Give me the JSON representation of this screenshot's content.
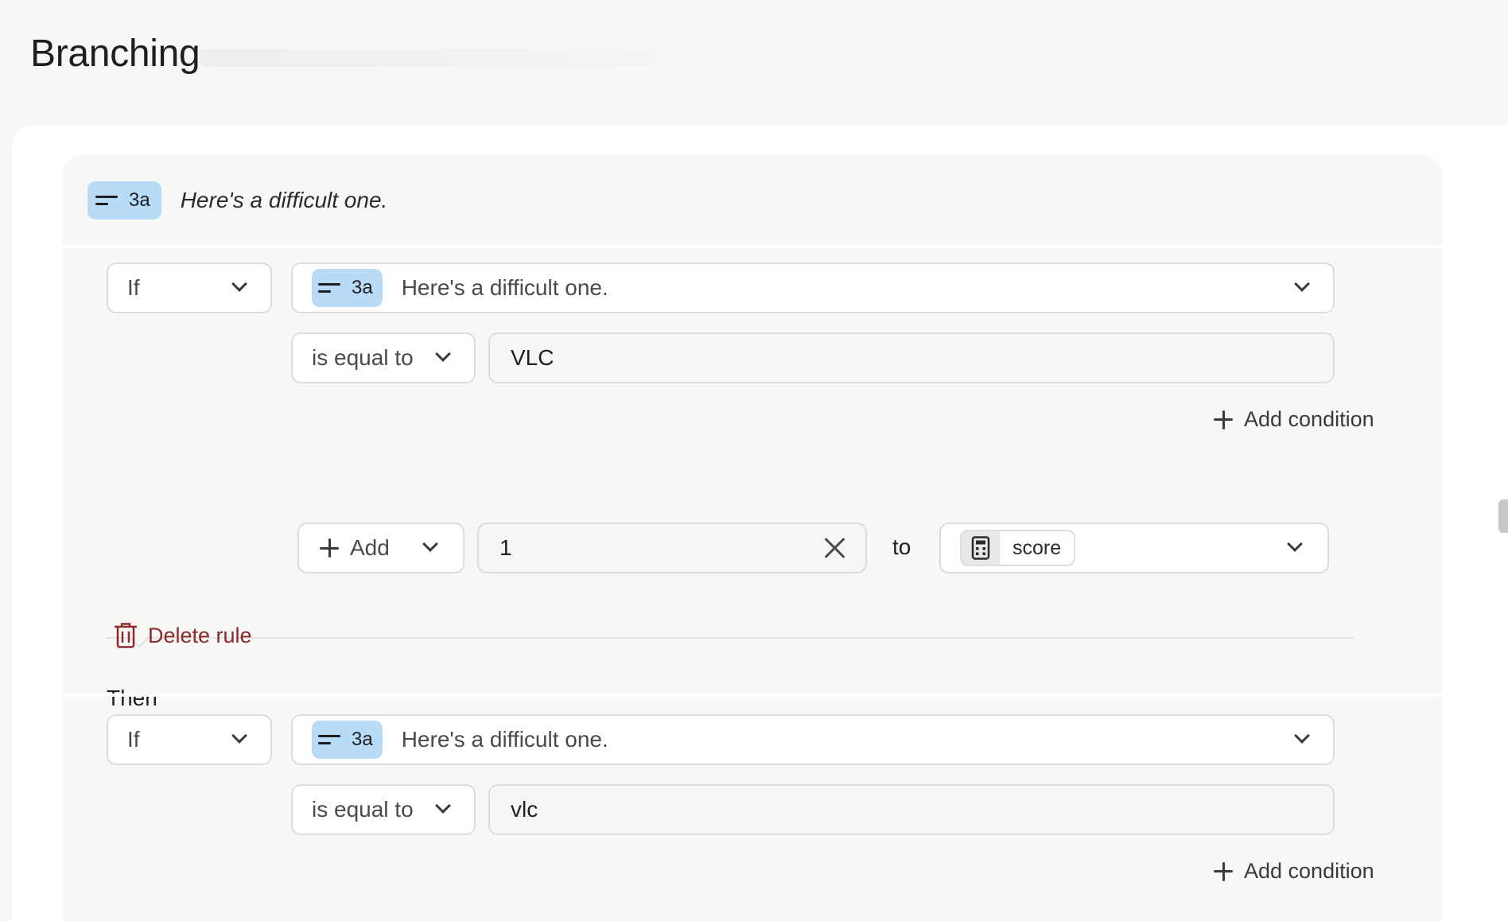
{
  "page": {
    "title": "Branching"
  },
  "question": {
    "tag": "3a",
    "text": "Here's a difficult one."
  },
  "rules": [
    {
      "if_label": "If",
      "question_tag": "3a",
      "question_text": "Here's a difficult one.",
      "operator": "is equal to",
      "value": "VLC",
      "add_condition_label": "Add condition",
      "then_label": "Then",
      "action_label": "Add",
      "action_value": "1",
      "to_label": "to",
      "variable": "score",
      "delete_label": "Delete rule"
    },
    {
      "if_label": "If",
      "question_tag": "3a",
      "question_text": "Here's a difficult one.",
      "operator": "is equal to",
      "value": "vlc",
      "add_condition_label": "Add condition"
    }
  ],
  "colors": {
    "badge": "#b8dcf8",
    "danger": "#8a2a2a",
    "panel": "#f7f7f6"
  }
}
